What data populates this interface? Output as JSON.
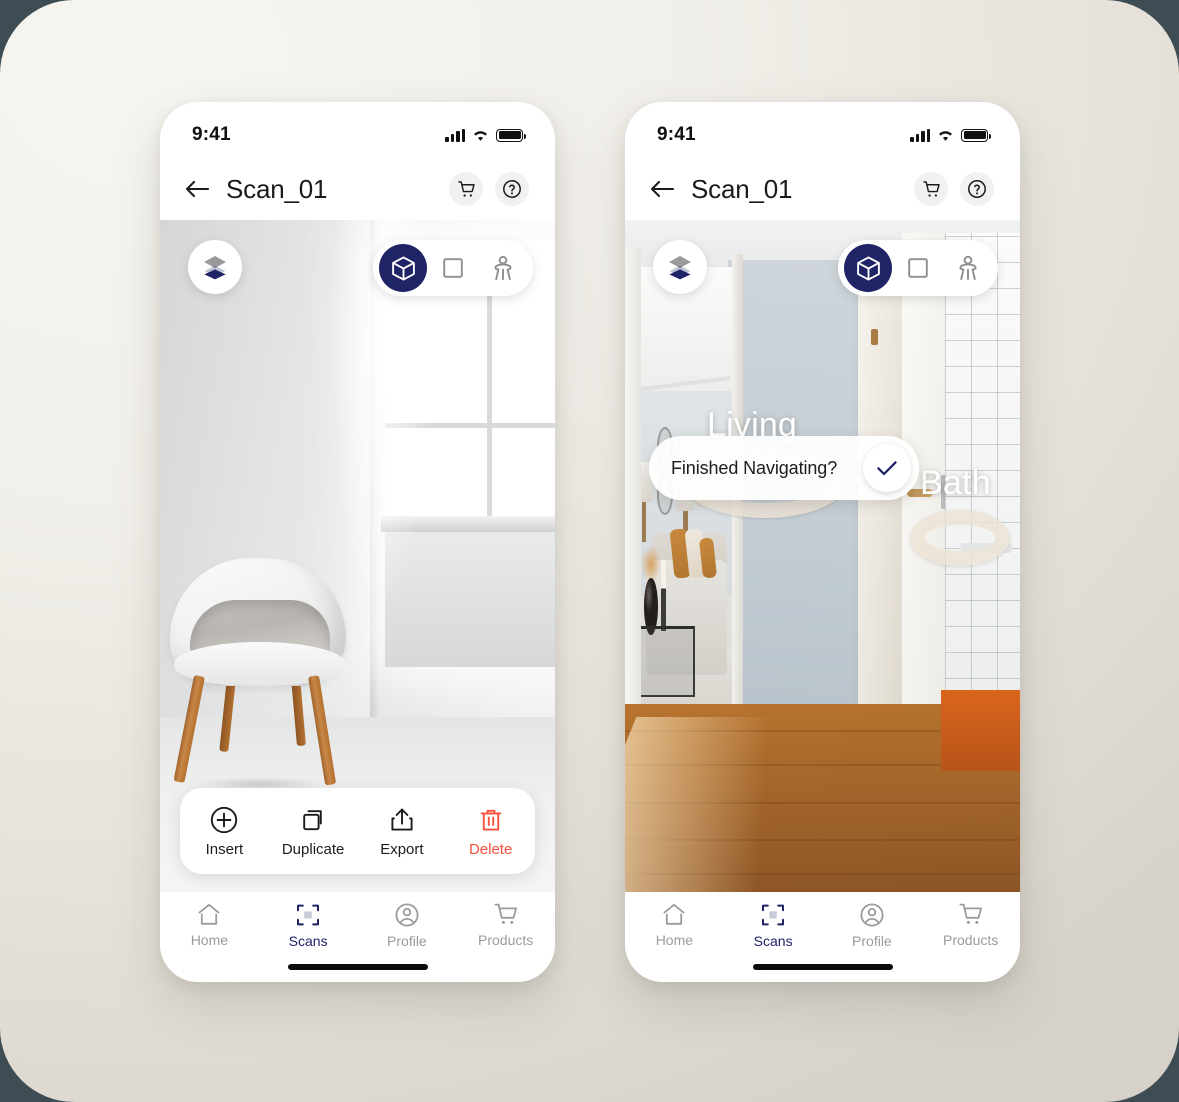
{
  "theme": {
    "accent_navy": "#1F2466",
    "danger_red": "#F9513C",
    "muted_gray": "#9b9b9f",
    "canvas_bg": "#F1EFE9"
  },
  "status_bar": {
    "time": "9:41"
  },
  "header": {
    "title": "Scan_01",
    "back_icon": "arrow-left-icon",
    "cart_icon": "cart-icon",
    "help_icon": "help-circle-icon"
  },
  "viewport_controls": {
    "layers_icon": "layers-icon",
    "modes": [
      {
        "id": "3d",
        "icon": "cube-icon",
        "active": true
      },
      {
        "id": "2d",
        "icon": "square-icon",
        "active": false
      },
      {
        "id": "walk",
        "icon": "walk-person-icon",
        "active": false
      }
    ]
  },
  "left_screen": {
    "scene": "white room with bucket chair and window",
    "action_bar": [
      {
        "label": "Insert",
        "icon": "plus-circle-icon",
        "danger": false
      },
      {
        "label": "Duplicate",
        "icon": "copy-icon",
        "danger": false
      },
      {
        "label": "Export",
        "icon": "share-up-icon",
        "danger": false
      },
      {
        "label": "Delete",
        "icon": "trash-icon",
        "danger": true
      }
    ]
  },
  "right_screen": {
    "scene": "AR hallway view with open door to living room and bathroom",
    "toast": {
      "text": "Finished Navigating?",
      "confirm_icon": "check-icon"
    },
    "waypoints": [
      {
        "label": "Living"
      },
      {
        "label": "Bath"
      }
    ]
  },
  "bottom_nav": [
    {
      "label": "Home",
      "icon": "home-icon",
      "active": false
    },
    {
      "label": "Scans",
      "icon": "scan-frame-icon",
      "active": true
    },
    {
      "label": "Profile",
      "icon": "user-circle-icon",
      "active": false
    },
    {
      "label": "Products",
      "icon": "cart-icon",
      "active": false
    }
  ]
}
